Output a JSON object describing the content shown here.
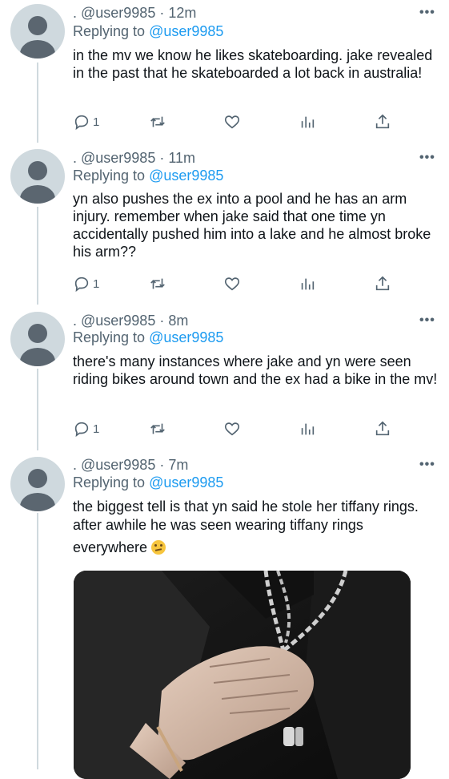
{
  "tweets": [
    {
      "handle": ". @user9985",
      "time": "· 12m",
      "replying_label": "Replying to",
      "replying_to": "@user9985",
      "text": "in the mv we know he likes skateboarding. jake revealed in the past that he skateboarded a lot back in  australia!",
      "reply_count": "1"
    },
    {
      "handle": ". @user9985",
      "time": "· 11m",
      "replying_label": "Replying to",
      "replying_to": "@user9985",
      "text": "yn also pushes the ex into a pool and he has an arm injury. remember when jake said that one time yn accidentally pushed him into a lake and he almost broke his arm??",
      "reply_count": "1"
    },
    {
      "handle": ". @user9985",
      "time": "· 8m",
      "replying_label": "Replying to",
      "replying_to": "@user9985",
      "text": "there's many instances where jake and yn were seen riding bikes around town and the ex had a bike in the mv!",
      "reply_count": "1"
    },
    {
      "handle": ". @user9985",
      "time": "· 7m",
      "replying_label": "Replying to",
      "replying_to": "@user9985",
      "text_line1": "the biggest tell is that yn said he stole her tiffany rings. after awhile he was seen wearing tiffany rings",
      "text_line2": "everywhere",
      "emoji": "thinking-face"
    }
  ],
  "more_label": "•••",
  "icons": [
    "reply-icon",
    "retweet-icon",
    "like-icon",
    "views-icon",
    "share-icon"
  ],
  "colors": {
    "accent": "#1d9bf0",
    "muted": "#536471",
    "text": "#0f1419"
  }
}
